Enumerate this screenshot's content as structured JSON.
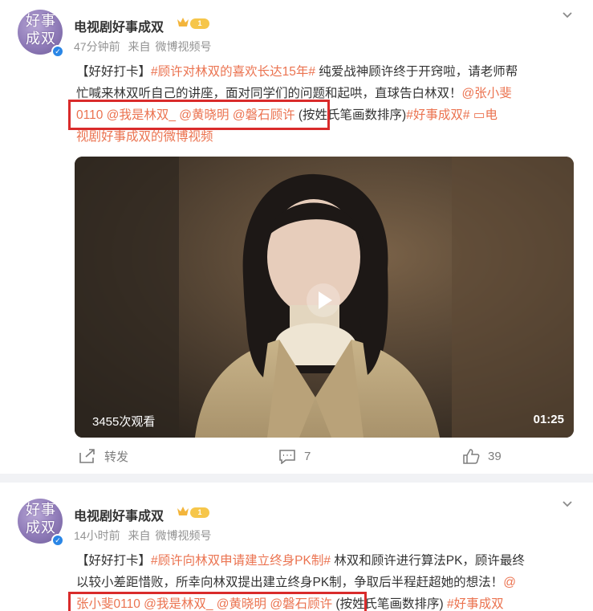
{
  "posts": [
    {
      "author": "电视剧好事成双",
      "level": "1",
      "time": "47分钟前",
      "source_prefix": "来自",
      "source": "微博视频号",
      "avatar_text": "好事成双",
      "text": {
        "line1_a": "【好好打卡】",
        "line1_tag": "#顾许对林双的喜欢长达15年#",
        "line1_b": " 纯爱战神顾许终于开窍啦，请老师帮",
        "line2": "忙喊来林双听自己的讲座，面对同学们的问题和起哄，直球告白林双！",
        "line2_tag": "@张小斐",
        "line3_tags": "0110 @我是林双_ @黄晓明 @磐石顾许",
        "line3_b": " (按姓氏笔画数排序)",
        "line3_tag2": "#好事成双#",
        "line3_link": "电",
        "line4_link": "视剧好事成双的微博视频"
      },
      "video": {
        "views": "3455次观看",
        "duration": "01:25"
      },
      "actions": {
        "repost": "转发",
        "comments": "7",
        "likes": "39"
      }
    },
    {
      "author": "电视剧好事成双",
      "level": "1",
      "time": "14小时前",
      "source_prefix": "来自",
      "source": "微博视频号",
      "avatar_text": "好事成双",
      "text": {
        "line1_a": "【好好打卡】",
        "line1_tag": "#顾许向林双申请建立终身PK制#",
        "line1_b": " 林双和顾许进行算法PK，顾许最终",
        "line2": "以较小差距惜败，所幸向林双提出建立终身PK制，争取后半程赶超她的想法！",
        "line2_tag": "@",
        "line3_tags": "张小斐0110 @我是林双_ @黄晓明 @磐石顾许",
        "line3_b": " (按姓氏笔画数排序)",
        "line3_tag2": "#好事成双"
      }
    }
  ],
  "colors": {
    "accent": "#eb7350",
    "highlight_box": "#d92b2b",
    "verified": "#2a86e6",
    "meta": "#939393"
  },
  "icons": [
    "chevron-down-icon",
    "verified-icon",
    "crown-icon",
    "play-icon",
    "repost-icon",
    "comment-icon",
    "like-icon",
    "video-link-icon"
  ]
}
